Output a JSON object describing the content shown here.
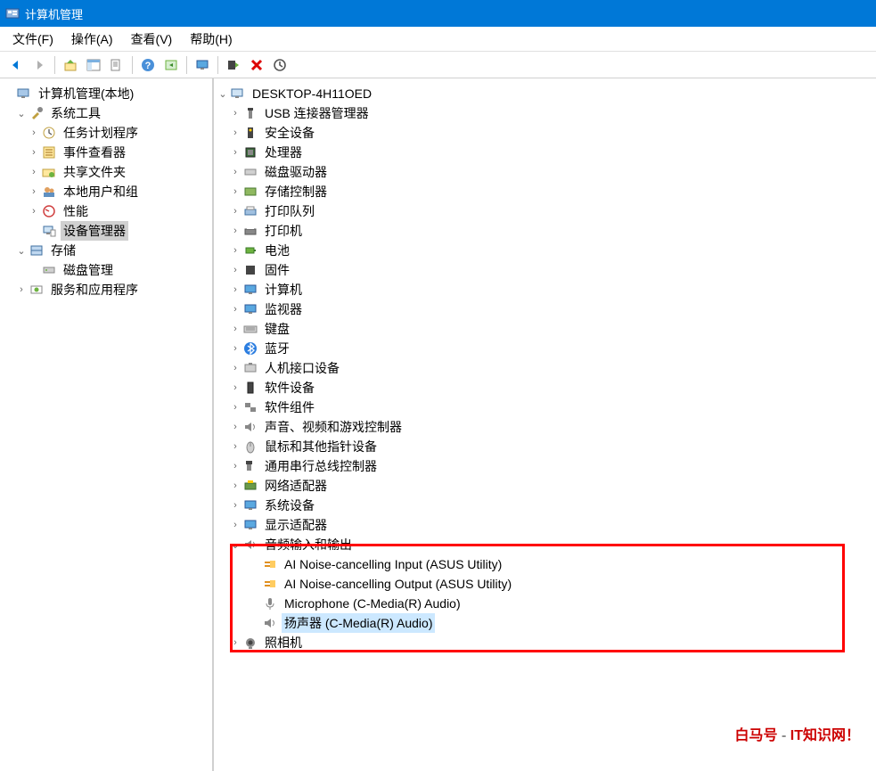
{
  "window": {
    "title": "计算机管理"
  },
  "menu": {
    "file": "文件(F)",
    "action": "操作(A)",
    "view": "查看(V)",
    "help": "帮助(H)"
  },
  "left_tree": {
    "root": "计算机管理(本地)",
    "system_tools": "系统工具",
    "task_scheduler": "任务计划程序",
    "event_viewer": "事件查看器",
    "shared_folders": "共享文件夹",
    "local_users": "本地用户和组",
    "performance": "性能",
    "device_manager": "设备管理器",
    "storage": "存储",
    "disk_management": "磁盘管理",
    "services_apps": "服务和应用程序"
  },
  "right_tree": {
    "root": "DESKTOP-4H11OED",
    "usb_connector": "USB 连接器管理器",
    "security_devices": "安全设备",
    "processors": "处理器",
    "disk_drives": "磁盘驱动器",
    "storage_controllers": "存储控制器",
    "print_queues": "打印队列",
    "printers": "打印机",
    "batteries": "电池",
    "firmware": "固件",
    "computer": "计算机",
    "monitors": "监视器",
    "keyboards": "键盘",
    "bluetooth": "蓝牙",
    "hid": "人机接口设备",
    "software_devices": "软件设备",
    "software_components": "软件组件",
    "sound_video_game": "声音、视频和游戏控制器",
    "mice_pointing": "鼠标和其他指针设备",
    "usb_controllers": "通用串行总线控制器",
    "network_adapters": "网络适配器",
    "system_devices": "系统设备",
    "display_adapters": "显示适配器",
    "audio_io": "音频输入和输出",
    "audio_child1": "AI Noise-cancelling Input (ASUS Utility)",
    "audio_child2": "AI Noise-cancelling Output (ASUS Utility)",
    "audio_child3": "Microphone (C-Media(R) Audio)",
    "audio_child4": "扬声器 (C-Media(R) Audio)",
    "cameras": "照相机"
  },
  "watermark": {
    "brand": "白马号",
    "dash": " - ",
    "tagline": "IT知识网！"
  }
}
